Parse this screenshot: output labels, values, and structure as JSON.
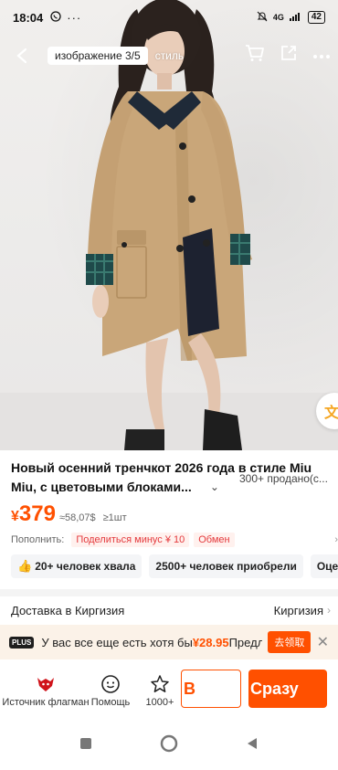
{
  "status_bar": {
    "time": "18:04",
    "network": "4G",
    "battery": "42"
  },
  "top_nav": {
    "gallery_tab": "изображение 3/5",
    "style_tab": "стиль"
  },
  "translate_button": "文",
  "product": {
    "title_line1": "Новый осенний тренчкот 2026 года в стиле Miu",
    "title_line2": "Miu, с цветовыми блоками...",
    "sold": "300+ продано(с...",
    "price_currency": "¥",
    "price_value": "379",
    "price_converted": "≈58,07$",
    "min_order": "≥1шт"
  },
  "promo": {
    "label": "Пополнить:",
    "chips": [
      "Поделиться минус ¥ 10",
      "Обмен"
    ]
  },
  "tags": [
    {
      "text": "20+ человек хвала",
      "icon": "thumbs-up-icon"
    },
    {
      "text": "2500+ человек приобрели"
    },
    {
      "text": "Оценка н"
    }
  ],
  "delivery": {
    "label": "Доставка в Киргизия",
    "value": "Киргизия"
  },
  "plus_banner": {
    "badge": "PLUS",
    "text_prefix": "У вас все еще есть хотя бы",
    "amount": "¥28.95",
    "text_suffix": "Предло",
    "button": "去领取"
  },
  "actions": {
    "store": "Источник флагман",
    "help": "Помощь",
    "favorites": "1000+",
    "cart_button": "В",
    "buy_button": "Сразу"
  },
  "colors": {
    "accent": "#ff5000",
    "coat": "#c9a679",
    "collar": "#1f2a38",
    "plaid": "#1f4a4a"
  }
}
